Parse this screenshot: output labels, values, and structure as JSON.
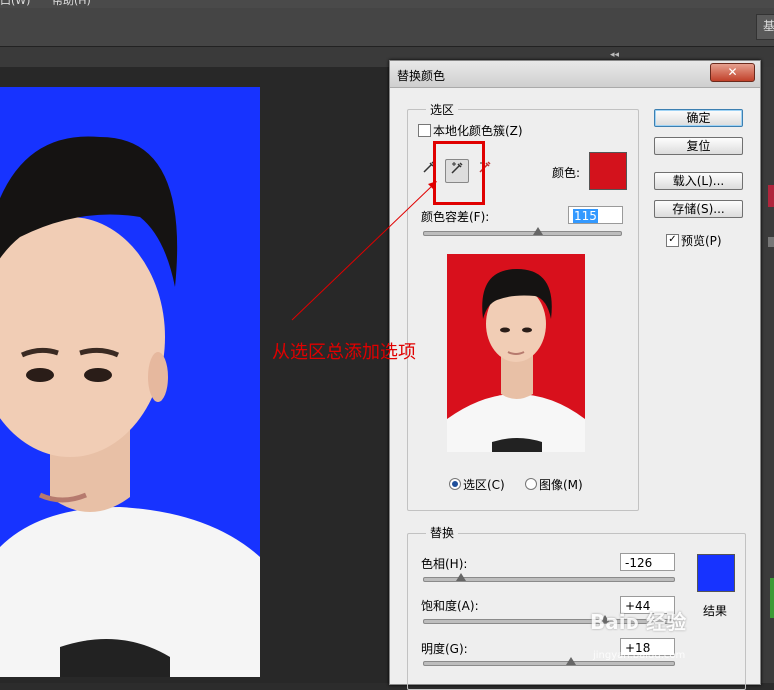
{
  "menubar": {
    "items": [
      "口(W)",
      "帮助(H)"
    ]
  },
  "optionsbar": {
    "right_button": "基"
  },
  "panel_collapse": "◂◂",
  "dialog": {
    "title": "替换颜色",
    "close_label": "✕",
    "selection": {
      "group_label": "选区",
      "localized_label": "本地化颜色簇(Z)",
      "localized_checked": false,
      "color_label": "颜色:",
      "color": "#d3121c",
      "fuzziness_label": "颜色容差(F):",
      "fuzziness_value": "115",
      "fuzziness_fraction": 0.57,
      "radio_selection": "选区(C)",
      "radio_image": "图像(M)",
      "selected_mode": "selection"
    },
    "buttons": {
      "ok": "确定",
      "reset": "复位",
      "load": "载入(L)...",
      "save": "存储(S)..."
    },
    "preview_label": "预览(P)",
    "preview_checked": true,
    "replace": {
      "group_label": "替换",
      "hue_label": "色相(H):",
      "hue_value": "-126",
      "hue_fraction": 0.15,
      "saturation_label": "饱和度(A):",
      "saturation_value": "+44",
      "saturation_fraction": 0.72,
      "lightness_label": "明度(G):",
      "lightness_value": "+18",
      "lightness_fraction": 0.59,
      "result_label": "结果",
      "result_color": "#1733ff"
    }
  },
  "annotation": "从选区总添加选项",
  "watermark": {
    "main": "Baiᴅ 经验",
    "sub": "jingyan.baidu.com"
  },
  "colors": {
    "photo_bg": "#1733ff",
    "preview_bg": "#d8101c",
    "annotation": "#e00000"
  }
}
